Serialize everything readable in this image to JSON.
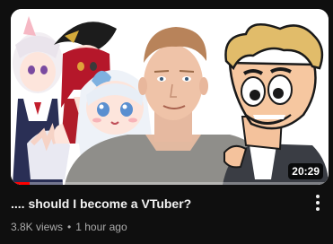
{
  "video": {
    "title": ".... should I become a VTuber?",
    "views": "3.8K views",
    "separator": "•",
    "age": "1 hour ago",
    "duration": "20:29",
    "watch_progress": 0.06
  },
  "icons": {
    "menu": "more-vert-icon"
  },
  "colors": {
    "background": "#0f0f0f",
    "title": "#f1f1f1",
    "meta": "#aaaaaa",
    "progress": "#ff0000"
  }
}
